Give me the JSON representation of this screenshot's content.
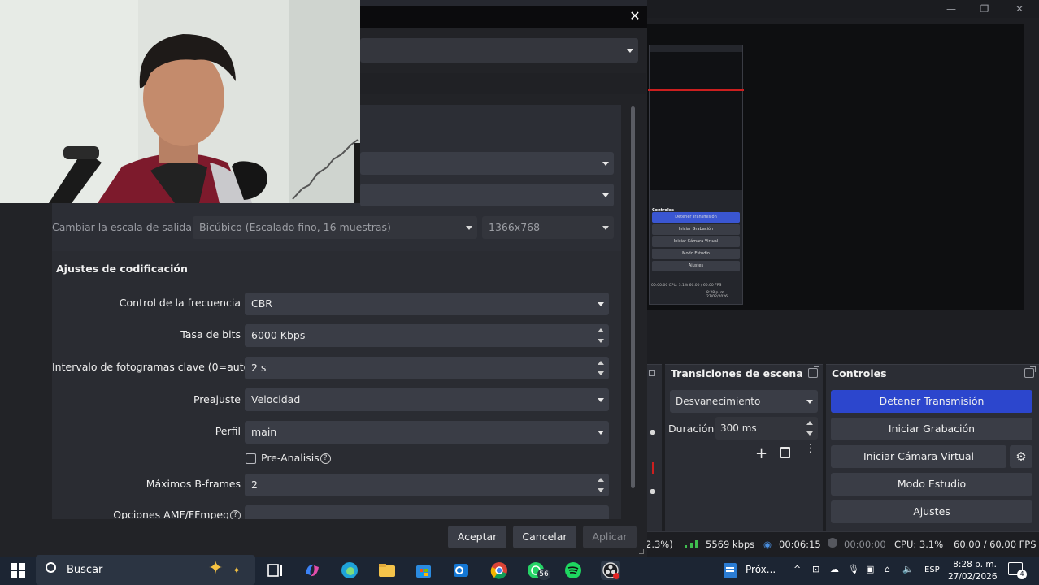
{
  "dialog": {
    "close": "✕",
    "scale_label": "Cambiar la escala de salida",
    "scale_filter": "Bicúbico (Escalado fino, 16 muestras)",
    "scale_resolution": "1366x768",
    "encoding_group_title": "Ajustes de codificación",
    "fields": [
      {
        "label": "Control de la frecuencia",
        "value": "CBR",
        "kind": "combo"
      },
      {
        "label": "Tasa de bits",
        "value": "6000 Kbps",
        "kind": "spin"
      },
      {
        "label": "Intervalo de fotogramas clave (0=auto)",
        "value": "2 s",
        "kind": "spin"
      },
      {
        "label": "Preajuste",
        "value": "Velocidad",
        "kind": "combo"
      },
      {
        "label": "Perfil",
        "value": "main",
        "kind": "combo"
      }
    ],
    "pre_analysis_label": "Pre-Analisis",
    "help_glyph": "?",
    "bframes_label": "Máximos B-frames",
    "bframes_value": "2",
    "ffmpeg_options_label": "Opciones AMF/FFmpeg",
    "buttons": {
      "accept": "Aceptar",
      "cancel": "Cancelar",
      "apply": "Aplicar"
    }
  },
  "obs": {
    "window_controls": {
      "minimize": "—",
      "restore": "❐",
      "close": "✕"
    },
    "transitions": {
      "title": "Transiciones de escena",
      "transition": "Desvanecimiento",
      "duration_label": "Duración",
      "duration_value": "300 ms"
    },
    "controls": {
      "title": "Controles",
      "stop_stream": "Detener Transmisión",
      "start_recording": "Iniciar Grabación",
      "start_virtual_cam": "Iniciar Cámara Virtual",
      "studio_mode": "Modo Estudio",
      "settings": "Ajustes"
    },
    "mini_preview": {
      "controls_title": "Controles",
      "rows": [
        "Detener Transmisión",
        "Iniciar Grabación",
        "Iniciar Cámara Virtual",
        "Modo Estudio",
        "Ajustes"
      ],
      "status": "00:00:00   CPU: 3.1%   60.00 / 60.00 FPS",
      "time": "8:28 p. m.",
      "date": "27/02/2026"
    },
    "status": {
      "dropped": "2.3%)",
      "bitrate": "5569 kbps",
      "stream_time": "00:06:15",
      "rec_time": "00:00:00",
      "cpu": "CPU: 3.1%",
      "fps": "60.00 / 60.00 FPS"
    }
  },
  "taskbar": {
    "search_placeholder": "Buscar",
    "whatsapp_badge": "56",
    "word_label": "Próx...",
    "language": "ESP",
    "time": "8:28 p. m.",
    "date": "27/02/2026",
    "notification_count": "4"
  },
  "colors": {
    "accent_blue": "#2c46cd",
    "live_red": "#cc1f1f",
    "taskbar": "#1c2533"
  }
}
